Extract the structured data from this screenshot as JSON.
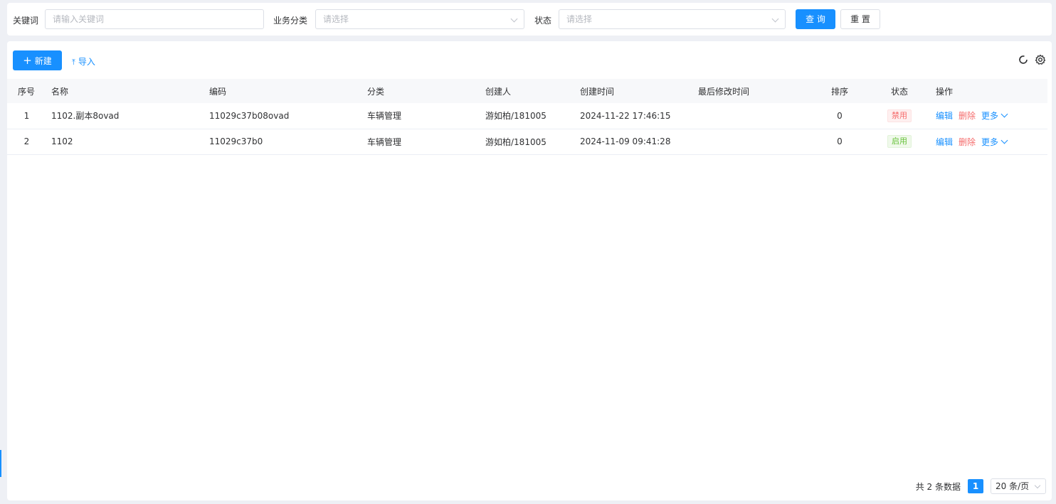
{
  "search": {
    "keyword_label": "关键词",
    "keyword_placeholder": "请输入关键词",
    "category_label": "业务分类",
    "category_placeholder": "请选择",
    "status_label": "状态",
    "status_placeholder": "请选择",
    "query_button": "查 询",
    "reset_button": "重 置"
  },
  "toolbar": {
    "new_label": "新建",
    "import_label": "导入",
    "refresh_icon": "refresh-icon",
    "settings_icon": "gear-icon"
  },
  "table": {
    "columns": [
      "序号",
      "名称",
      "编码",
      "分类",
      "创建人",
      "创建时间",
      "最后修改时间",
      "排序",
      "状态",
      "操作"
    ],
    "rows": [
      {
        "index": "1",
        "name": "1102.副本8ovad",
        "code": "11029c37b08ovad",
        "category": "车辆管理",
        "creator": "游如柏/181005",
        "created_at": "2024-11-22 17:46:15",
        "modified_at": "",
        "sort": "0",
        "status": "禁用",
        "actions": {
          "edit": "编辑",
          "delete": "删除",
          "more": "更多"
        }
      },
      {
        "index": "2",
        "name": "1102",
        "code": "11029c37b0",
        "category": "车辆管理",
        "creator": "游如柏/181005",
        "created_at": "2024-11-09 09:41:28",
        "modified_at": "",
        "sort": "0",
        "status": "启用",
        "actions": {
          "edit": "编辑",
          "delete": "删除",
          "more": "更多"
        }
      }
    ]
  },
  "pagination": {
    "total_text": "共 2 条数据",
    "current_page": "1",
    "page_size": "20 条/页"
  },
  "colors": {
    "primary": "#1890ff",
    "danger": "#f56c6c",
    "success": "#67c23a"
  }
}
